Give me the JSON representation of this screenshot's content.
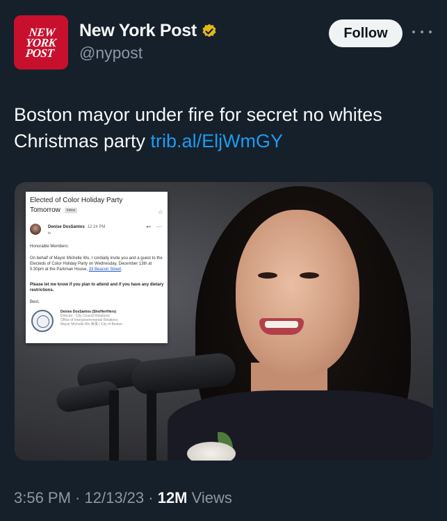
{
  "account": {
    "logo_text": "NEW\nYORK\nPOST",
    "display_name": "New York Post",
    "handle": "@nypost",
    "verified_icon": "gold-verified-badge-icon"
  },
  "actions": {
    "follow_label": "Follow",
    "more_icon": "more-dots-icon"
  },
  "tweet": {
    "text": "Boston mayor under fire for secret no whites Christmas party ",
    "link": "trib.al/EljWmGY"
  },
  "email": {
    "subject": "Elected of Color Holiday Party",
    "subject2": "Tomorrow",
    "inbox_tag": "Inbox",
    "sender": "Denise DosSantos",
    "time": "12:24 PM",
    "to": "to",
    "salutation": "Honorable Members:",
    "body1": "On behalf of Mayor Michelle Wu, I cordially invite you and a guest to the Electeds of Color Holiday Party on Wednesday, December 13th at 5:30pm at the Parkman House, ",
    "body1_link": "33 Beacon Street",
    "body1_end": ".",
    "body2": "Please let me know if you plan to attend and if you have any dietary restrictions.",
    "closing": "Best,",
    "sig_name": "Denise DosSantos (She/Her/Hers)",
    "sig_line1": "Director - City Council Relations",
    "sig_line2": "Office of Intergovernmental Relations",
    "sig_line3": "Mayor Michelle Wu 吳弭 | City of Boston"
  },
  "meta": {
    "time": "3:56 PM",
    "separator": " · ",
    "date": "12/13/23",
    "views_count": "12M",
    "views_label": " Views"
  },
  "colors": {
    "background": "#15202b",
    "link": "#1d9bf0",
    "logo_red": "#c8102e",
    "secondary_text": "#8b98a5"
  }
}
